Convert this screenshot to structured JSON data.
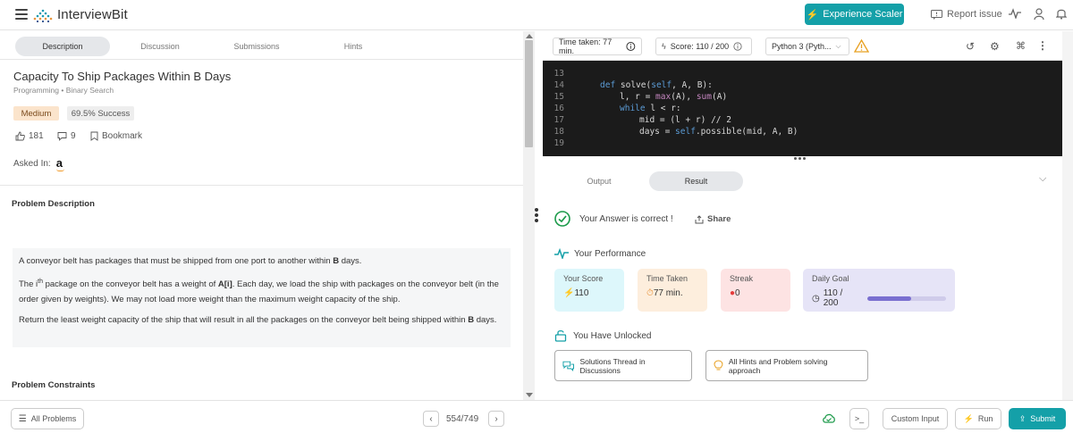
{
  "header": {
    "logo": "InterviewBit",
    "experience_button": "Experience Scaler",
    "report_issue": "Report issue"
  },
  "left_tabs": [
    "Description",
    "Discussion",
    "Submissions",
    "Hints"
  ],
  "problem": {
    "title": "Capacity To Ship Packages Within B Days",
    "breadcrumb_1": "Programming",
    "breadcrumb_2": "Binary Search",
    "difficulty": "Medium",
    "success": "69.5% Success",
    "likes": "181",
    "comments": "9",
    "bookmark": "Bookmark",
    "asked_in": "Asked In:",
    "asked_logo": "a",
    "description_heading": "Problem Description",
    "para1_a": "A conveyor belt has packages that must be shipped from one port to another within ",
    "para1_b": "B",
    "para1_c": " days.",
    "para2_a": "The i",
    "para2_sup": "th",
    "para2_b": " package on the conveyor belt has a weight of ",
    "para2_c": "A[i]",
    "para2_d": ". Each day, we load the ship with packages on the conveyor belt (in the order given by weights). We may not load more weight than the maximum weight capacity of the ship.",
    "para3_a": "Return the least weight capacity of the ship that will result in all the packages on the conveyor belt being shipped within ",
    "para3_b": "B",
    "para3_c": " days.",
    "constraints_heading": "Problem Constraints"
  },
  "editor": {
    "time_taken": "Time taken: 77 min.",
    "score": "Score: 110 / 200",
    "language": "Python 3 (Pyth...",
    "line_numbers": [
      "13",
      "14",
      "15",
      "16",
      "17",
      "18",
      "19"
    ],
    "code_14_a": "def",
    "code_14_b": " solve(",
    "code_14_c": "self",
    "code_14_d": ", A, B):",
    "code_15_a": "l, r = ",
    "code_15_b": "max",
    "code_15_c": "(A), ",
    "code_15_d": "sum",
    "code_15_e": "(A)",
    "code_16_a": "while",
    "code_16_b": " l < r:",
    "code_17": "mid = (l + r) // 2",
    "code_18_a": "days = ",
    "code_18_b": "self",
    "code_18_c": ".possible(mid, A, B)"
  },
  "output_tabs": [
    "Output",
    "Result"
  ],
  "result": {
    "correct": "Your Answer is correct !",
    "share": "Share",
    "performance": "Your Performance",
    "score_label": "Your Score",
    "score_value": "110",
    "time_label": "Time Taken",
    "time_value": "77 min.",
    "streak_label": "Streak",
    "streak_value": "0",
    "goal_label": "Daily Goal",
    "goal_value": "110 / 200",
    "goal_progress": 0.55,
    "unlocked": "You Have Unlocked",
    "unlock_1": "Solutions Thread in Discussions",
    "unlock_2": "All Hints and Problem solving approach"
  },
  "footer": {
    "all_problems": "All Problems",
    "page": "554/749",
    "custom_input": "Custom Input",
    "run": "Run",
    "submit": "Submit"
  },
  "colors": {
    "accent": "#14a0a8",
    "medium_badge": "#fbe4cc",
    "score_card": "#ddf7fb",
    "time_card": "#fdeedd",
    "streak_card": "#fde3e3",
    "goal_card": "#e6e4f7"
  }
}
